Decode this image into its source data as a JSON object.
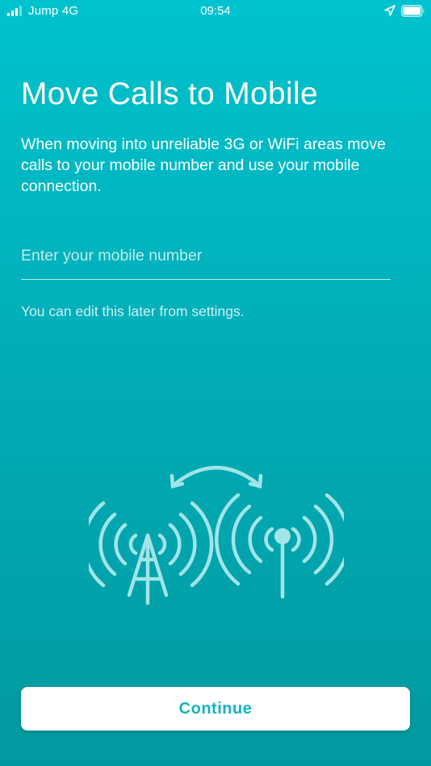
{
  "status_bar": {
    "carrier": "Jump 4G",
    "time": "09:54",
    "icons": [
      "signal-icon",
      "location-icon",
      "battery-icon"
    ]
  },
  "page": {
    "title": "Move Calls to Mobile",
    "description": "When moving into unreliable 3G or WiFi areas move calls to your mobile number and use your mobile connection.",
    "input_placeholder": "Enter your mobile number",
    "input_value": "",
    "hint": "You can edit this later from settings.",
    "illustration_icon": "cell-tower-swap-icon"
  },
  "actions": {
    "continue_label": "Continue"
  },
  "colors": {
    "background_top": "#00c2ce",
    "background_bottom": "#0399a1",
    "accent": "#15b3bd",
    "button_bg": "#ffffff"
  }
}
